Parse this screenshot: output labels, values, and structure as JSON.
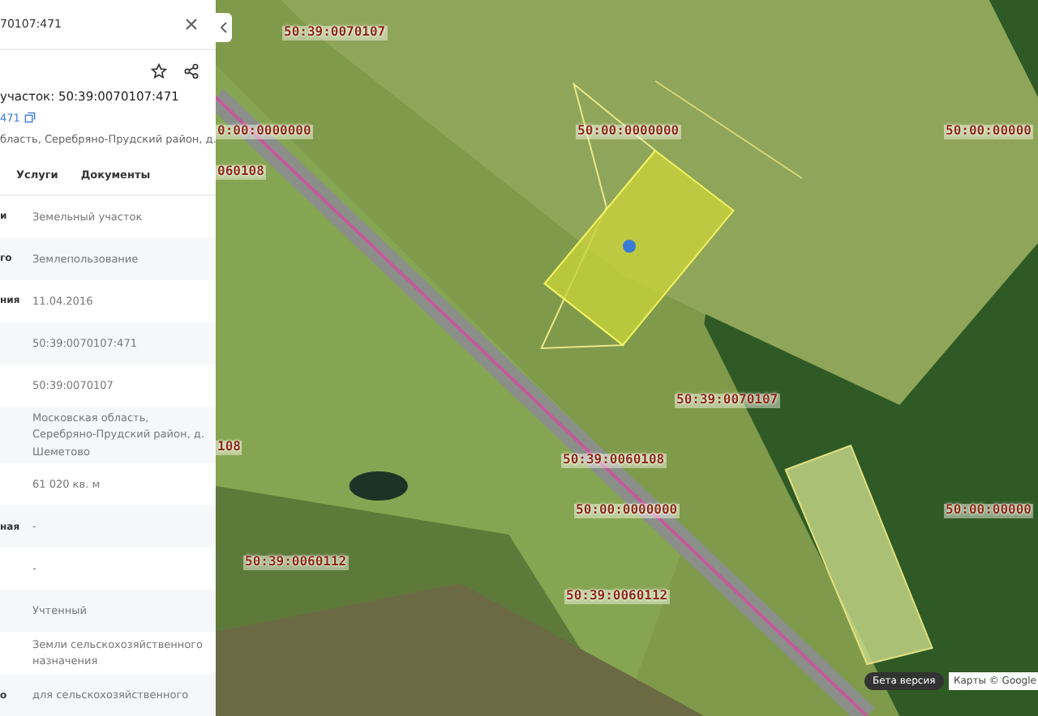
{
  "panel": {
    "header_title": "70107:471",
    "title": "участок: 50:39:0070107:471",
    "number_link": "471",
    "address": "бласть, Серебряно-Прудский район, д.",
    "tabs": [
      {
        "label": "Услуги"
      },
      {
        "label": "Документы"
      }
    ],
    "rows": [
      {
        "label": "и",
        "value": "Земельный участок"
      },
      {
        "label": "го",
        "value": "Землепользование"
      },
      {
        "label": "ния",
        "value": "11.04.2016"
      },
      {
        "label": "",
        "value": "50:39:0070107:471"
      },
      {
        "label": "",
        "value": "50:39:0070107"
      },
      {
        "label": "",
        "value": "Московская область, Серебряно-Прудский район, д. Шеметово"
      },
      {
        "label": "",
        "value": "61 020 кв. м"
      },
      {
        "label": "ная",
        "value": "-"
      },
      {
        "label": "",
        "value": "-"
      },
      {
        "label": "",
        "value": "Учтенный"
      },
      {
        "label": "",
        "value": "Земли сельскохозяйственного назначения"
      },
      {
        "label": "о",
        "value": "для сельскохозяйственного"
      }
    ]
  },
  "map": {
    "labels": [
      {
        "text": "50:39:0070107"
      },
      {
        "text": "0:00:0000000"
      },
      {
        "text": "50:00:0000000"
      },
      {
        "text": "50:00:00000"
      },
      {
        "text": "060108"
      },
      {
        "text": "50:39:0070107"
      },
      {
        "text": "108"
      },
      {
        "text": "50:39:0060108"
      },
      {
        "text": "50:00:0000000"
      },
      {
        "text": "50:00:00000"
      },
      {
        "text": "50:39:0060112"
      },
      {
        "text": "50:39:0060112"
      }
    ],
    "beta": "Бета версия",
    "copyright": "Карты © Google"
  }
}
